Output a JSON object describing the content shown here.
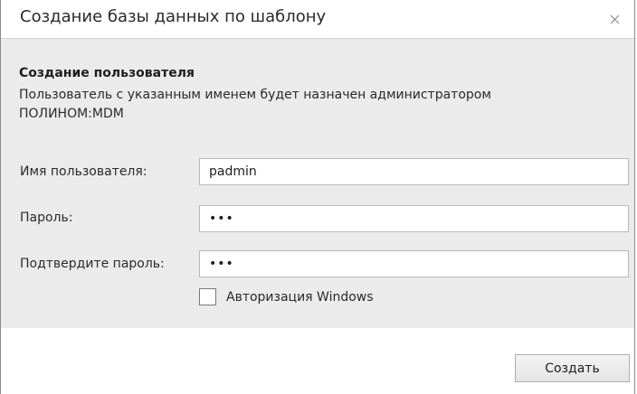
{
  "window": {
    "title": "Создание базы данных по шаблону",
    "close_icon": "close-x-icon"
  },
  "section": {
    "heading": "Создание пользователя",
    "description": "Пользователь с указанным именем будет назначен администратором ПОЛИНОМ:MDM"
  },
  "form": {
    "username": {
      "label": "Имя пользователя:",
      "value": "padmin"
    },
    "password": {
      "label": "Пароль:",
      "value": "•••"
    },
    "confirm_password": {
      "label": "Подтвердите пароль:",
      "value": "•••"
    },
    "windows_auth": {
      "label": "Авторизация Windows",
      "checked": false
    }
  },
  "footer": {
    "create_label": "Создать"
  }
}
